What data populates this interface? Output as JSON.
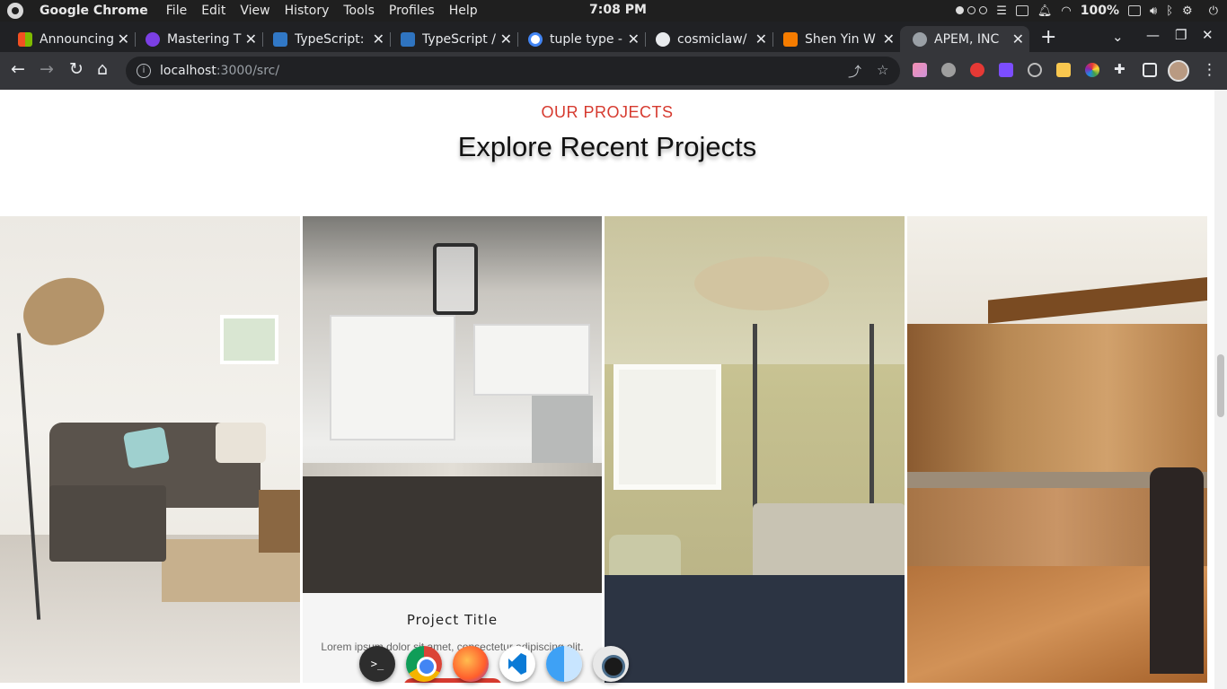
{
  "os": {
    "app_name": "Google Chrome",
    "menus": [
      "File",
      "Edit",
      "View",
      "History",
      "Tools",
      "Profiles",
      "Help"
    ],
    "clock": "7:08 PM",
    "battery": "100%"
  },
  "tabs": [
    {
      "title": "Announcing",
      "favicon_color": "#f25022"
    },
    {
      "title": "Mastering T",
      "favicon_color": "#7b3fe4"
    },
    {
      "title": "TypeScript:",
      "favicon_color": "#3178c6"
    },
    {
      "title": "TypeScript /",
      "favicon_color": "#2f74c0"
    },
    {
      "title": "tuple type -",
      "favicon_color": "#ffffff"
    },
    {
      "title": "cosmiclaw/",
      "favicon_color": "#e8eaed"
    },
    {
      "title": "Shen Yin W",
      "favicon_color": "#f57c00"
    },
    {
      "title": "APEM, INC",
      "favicon_color": "#9aa0a6",
      "active": true
    }
  ],
  "toolbar": {
    "url_host": "localhost",
    "url_path": ":3000/src/"
  },
  "page": {
    "subtitle": "OUR PROJECTS",
    "heading": "Explore Recent Projects",
    "projects": [
      {
        "name": "living-room"
      },
      {
        "name": "kitchen-white",
        "title": "Project Title",
        "description": "Lorem ipsum dolor sit amet, consectetur adipiscing elit."
      },
      {
        "name": "bedroom"
      },
      {
        "name": "kitchen-wood"
      }
    ]
  },
  "colors": {
    "accent": "#d63a2f",
    "chrome_dark": "#202124",
    "chrome_toolbar": "#35363a"
  },
  "dock": [
    "terminal-icon",
    "chrome-icon",
    "firefox-icon",
    "vscode-icon",
    "finder-icon",
    "camera-icon"
  ]
}
